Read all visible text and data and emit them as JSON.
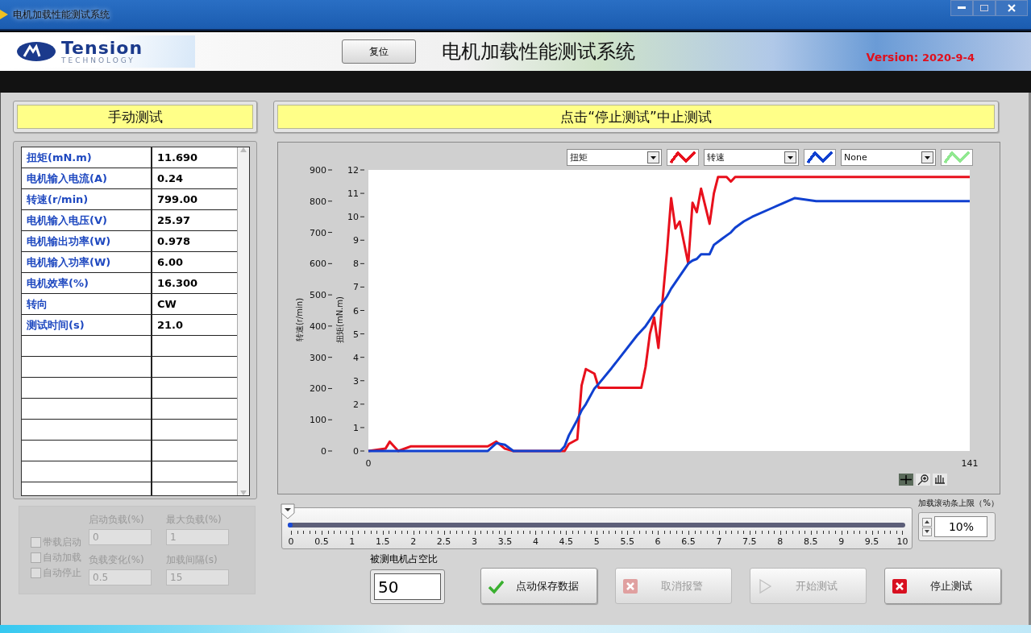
{
  "window": {
    "title": "电机加载性能测试系统"
  },
  "banner": {
    "logo_text": "Tension",
    "logo_subtext": "TECHNOLOGY",
    "reset_button": "复位",
    "title": "电机加载性能测试系统",
    "version_label": "Version:",
    "version": "2020-9-4"
  },
  "left_header": "手动测试",
  "right_header": "点击“停止测试”中止测试",
  "readings": [
    {
      "label": "扭矩(mN.m)",
      "value": "11.690"
    },
    {
      "label": "电机输入电流(A)",
      "value": "0.24"
    },
    {
      "label": "转速(r/min)",
      "value": "799.00"
    },
    {
      "label": "电机输入电压(V)",
      "value": "25.97"
    },
    {
      "label": "电机输出功率(W)",
      "value": "0.978"
    },
    {
      "label": "电机输入功率(W)",
      "value": "6.00"
    },
    {
      "label": "电机效率(%)",
      "value": "16.300"
    },
    {
      "label": "转向",
      "value": "CW"
    },
    {
      "label": "测试时间(s)",
      "value": "21.0"
    }
  ],
  "auto_options": {
    "checkboxes": [
      {
        "label": "带载启动",
        "checked": false,
        "disabled": true
      },
      {
        "label": "自动加载",
        "checked": false,
        "disabled": true
      },
      {
        "label": "自动停止",
        "checked": false,
        "disabled": true
      }
    ],
    "fields": [
      {
        "label": "启动负载(%)",
        "value": "0",
        "disabled": true
      },
      {
        "label": "最大负载(%)",
        "value": "1",
        "disabled": true
      },
      {
        "label": "负载变化(%)",
        "value": "0.5",
        "disabled": true
      },
      {
        "label": "加载间隔(s)",
        "value": "15",
        "disabled": true
      }
    ]
  },
  "graph": {
    "empty_plot_selector": {
      "value": "None",
      "color": "#90e890"
    },
    "chart_data": {
      "type": "line",
      "ylabel": "扭矩(mN.m)",
      "y2label": "转速(r/min)",
      "xlim": [
        0,
        141
      ],
      "ylim": [
        0,
        12
      ],
      "y2lim": [
        0,
        900
      ],
      "xticks": [
        0,
        141
      ],
      "yticks": [
        0,
        1,
        2,
        3,
        4,
        5,
        6,
        7,
        8,
        9,
        10,
        11,
        12
      ],
      "y2ticks": [
        0,
        100,
        200,
        300,
        400,
        500,
        600,
        700,
        800,
        900
      ],
      "x": [
        0,
        4,
        5,
        7,
        10,
        15,
        20,
        25,
        28,
        30,
        32,
        34,
        37,
        40,
        45,
        46,
        47,
        49,
        50,
        51,
        53,
        54,
        57,
        63,
        64,
        65,
        66,
        67,
        68,
        69,
        70,
        71,
        72,
        73,
        75,
        76,
        77,
        78,
        80,
        81,
        82,
        83,
        84,
        85,
        86,
        88,
        90,
        95,
        100,
        105,
        141
      ],
      "series": [
        {
          "name": "扭矩",
          "color": "#e8101c",
          "values": [
            0,
            0.1,
            0.4,
            0,
            0.2,
            0.2,
            0.2,
            0.2,
            0.2,
            0.4,
            0.1,
            0,
            0,
            0,
            0,
            0,
            0.3,
            0.5,
            2.8,
            3.5,
            3.3,
            2.7,
            2.7,
            2.7,
            2.7,
            3.6,
            5,
            5.7,
            4.4,
            6.5,
            8.5,
            10.8,
            9.5,
            9.8,
            8,
            10.6,
            10.2,
            11.2,
            9.7,
            11,
            11.7,
            11.7,
            11.7,
            11.5,
            11.7,
            11.7,
            11.7,
            11.7,
            11.7,
            11.7,
            11.7
          ]
        },
        {
          "name": "转速",
          "color": "#1040d0",
          "axis": "y2",
          "values": [
            0,
            0,
            0,
            0,
            0,
            0,
            0,
            0,
            0,
            25,
            20,
            0,
            0,
            0,
            0,
            15,
            50,
            100,
            130,
            150,
            200,
            215,
            265,
            370,
            385,
            400,
            420,
            440,
            460,
            475,
            495,
            520,
            540,
            560,
            600,
            610,
            615,
            630,
            630,
            660,
            670,
            680,
            690,
            700,
            715,
            735,
            750,
            780,
            810,
            800,
            800
          ]
        }
      ]
    }
  },
  "slider": {
    "level": 0,
    "ticks": [
      "0",
      "0.5",
      "1",
      "1.5",
      "2",
      "2.5",
      "3",
      "3.5",
      "4",
      "4.5",
      "5",
      "5.5",
      "6",
      "6.5",
      "7",
      "7.5",
      "8",
      "8.5",
      "9",
      "9.5",
      "10"
    ]
  },
  "duty_field": {
    "label": "被测电机占空比",
    "value": "50"
  },
  "scroll_limit": {
    "label": "加载滚动条上限（%）",
    "value": "10%"
  },
  "buttons": [
    {
      "label": "点动保存数据",
      "kind": "check",
      "disabled": false
    },
    {
      "label": "取消报警",
      "kind": "cross",
      "disabled": true
    },
    {
      "label": "开始测试",
      "kind": "play",
      "disabled": true
    },
    {
      "label": "停止测试",
      "kind": "cross",
      "disabled": false
    }
  ]
}
